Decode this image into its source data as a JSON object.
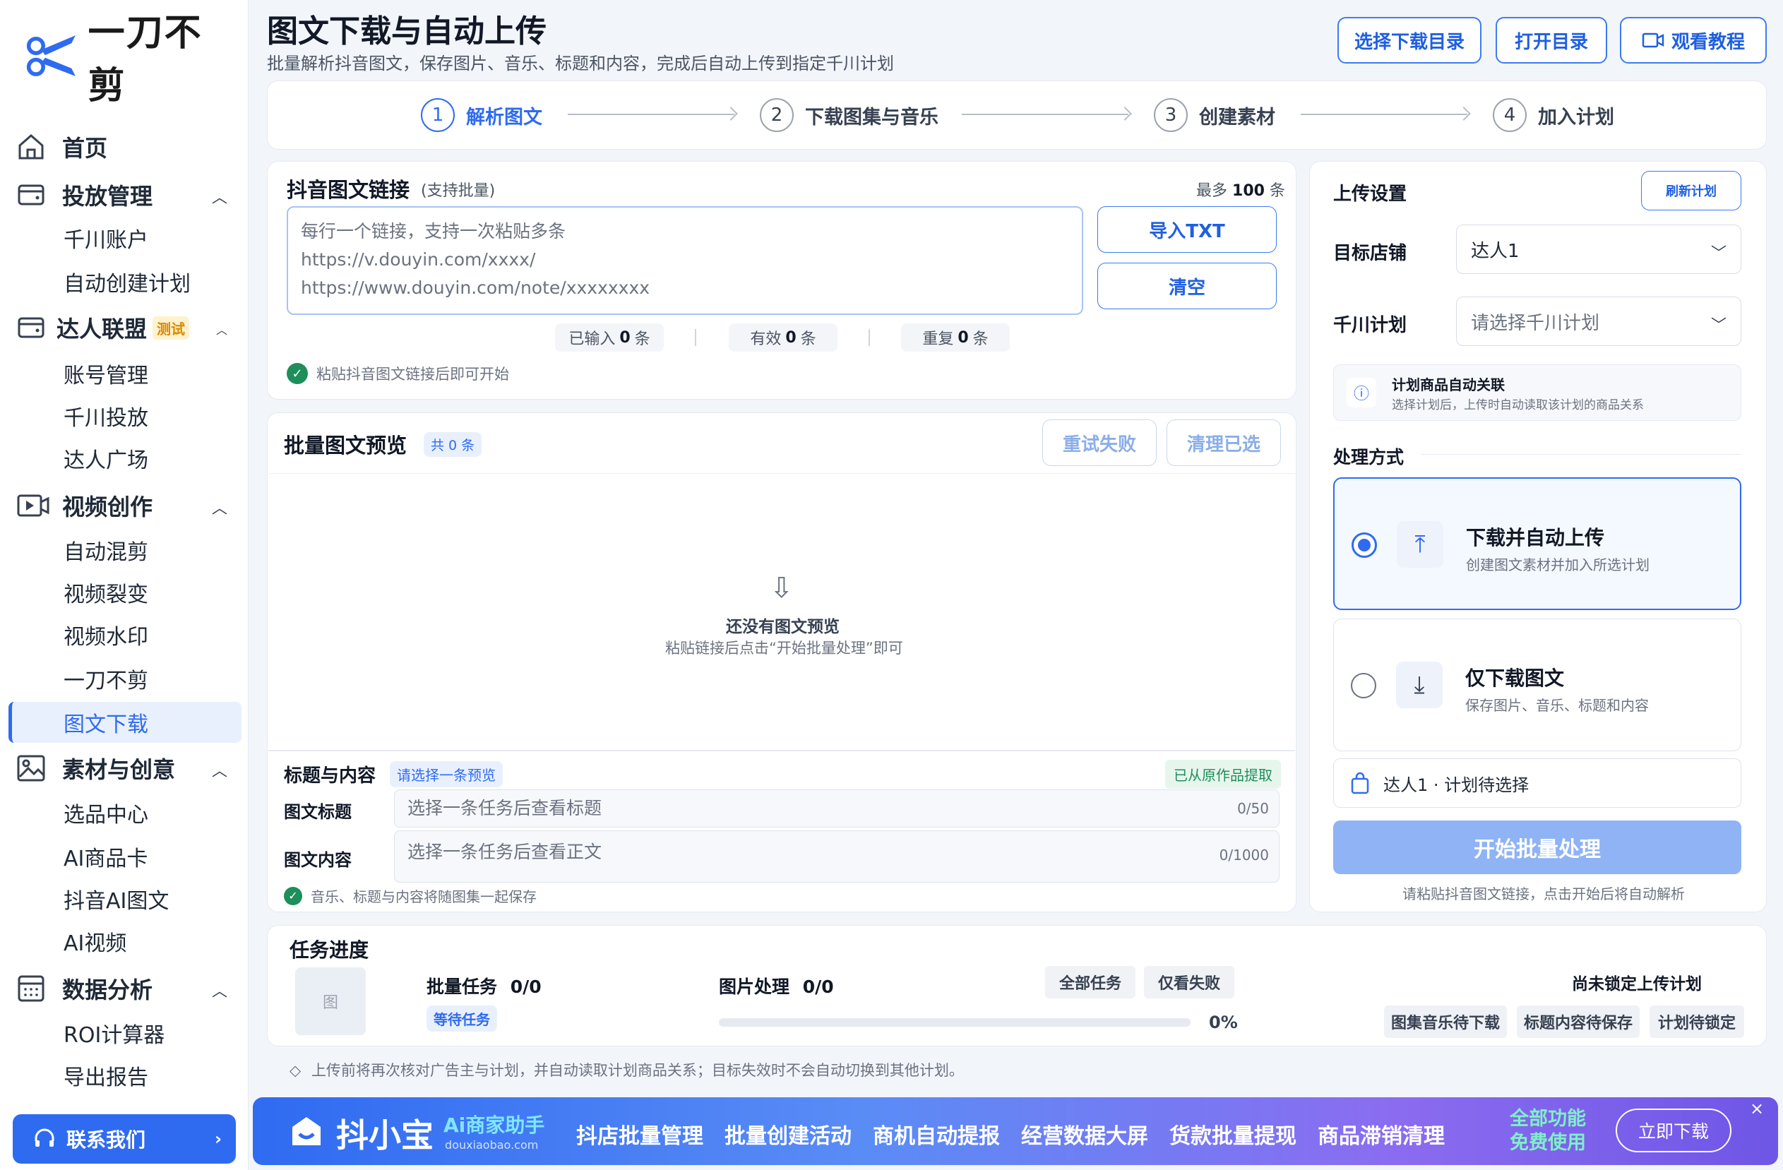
{
  "sidebar": {
    "logo_text": "一刀不剪",
    "home": "首页",
    "groups": [
      {
        "label": "投放管理",
        "items": [
          "千川账户",
          "自动创建计划"
        ]
      },
      {
        "label": "达人联盟",
        "badge": "测试",
        "items": [
          "账号管理",
          "千川投放",
          "达人广场"
        ]
      },
      {
        "label": "视频创作",
        "items": [
          "自动混剪",
          "视频裂变",
          "视频水印",
          "一刀不剪",
          "图文下载"
        ]
      },
      {
        "label": "素材与创意",
        "items": [
          "选品中心",
          "AI商品卡",
          "抖音AI图文",
          "AI视频"
        ]
      },
      {
        "label": "数据分析",
        "items": [
          "ROI计算器",
          "导出报告"
        ]
      }
    ],
    "active_item": "图文下载",
    "contact": "联系我们"
  },
  "header": {
    "title": "图文下载与自动上传",
    "subtitle": "批量解析抖音图文，保存图片、音乐、标题和内容，完成后自动上传到指定千川计划",
    "btn_select_dir": "选择下载目录",
    "btn_open_dir": "打开目录",
    "btn_tutorial": "观看教程"
  },
  "steps": [
    {
      "num": "1",
      "label": "解析图文"
    },
    {
      "num": "2",
      "label": "下载图集与音乐"
    },
    {
      "num": "3",
      "label": "创建素材"
    },
    {
      "num": "4",
      "label": "加入计划"
    }
  ],
  "links": {
    "title": "抖音图文链接",
    "hint": "(支持批量)",
    "max_prefix": "最多",
    "max_num": "100",
    "max_suffix": "条",
    "placeholder_lines": [
      "每行一个链接，支持一次粘贴多条",
      "https://v.douyin.com/xxxx/",
      "https://www.douyin.com/note/xxxxxxxx"
    ],
    "btn_import": "导入TXT",
    "btn_clear": "清空",
    "stats": [
      {
        "label": "已输入",
        "value": "0",
        "unit": "条"
      },
      {
        "label": "有效",
        "value": "0",
        "unit": "条"
      },
      {
        "label": "重复",
        "value": "0",
        "unit": "条"
      }
    ],
    "tip": "粘贴抖音图文链接后即可开始"
  },
  "preview": {
    "title": "批量图文预览",
    "count": "共 0 条",
    "btn_retry": "重试失败",
    "btn_clear_sel": "清理已选",
    "empty_title": "还没有图文预览",
    "empty_desc": "粘贴链接后点击“开始批量处理”即可",
    "meta_title": "标题与内容",
    "meta_chip": "请选择一条预览",
    "meta_badge": "已从原作品提取",
    "label_title": "图文标题",
    "title_placeholder": "选择一条任务后查看标题",
    "title_count": "0/50",
    "label_content": "图文内容",
    "content_placeholder": "选择一条任务后查看正文",
    "content_count": "0/1000",
    "save_tip": "音乐、标题与内容将随图集一起保存"
  },
  "upload": {
    "title": "上传设置",
    "btn_refresh": "刷新计划",
    "shop_label": "目标店铺",
    "shop_value": "达人1",
    "plan_label": "千川计划",
    "plan_placeholder": "请选择千川计划",
    "info_title": "计划商品自动关联",
    "info_desc": "选择计划后，上传时自动读取该计划的商品关系",
    "mode_label": "处理方式",
    "options": [
      {
        "title": "下载并自动上传",
        "desc": "创建图文素材并加入所选计划",
        "selected": true
      },
      {
        "title": "仅下载图文",
        "desc": "保存图片、音乐、标题和内容",
        "selected": false
      }
    ],
    "target": "达人1 · 计划待选择",
    "btn_start": "开始批量处理",
    "start_tip": "请粘贴抖音图文链接，点击开始后将自动解析"
  },
  "progress": {
    "title": "任务进度",
    "thumb": "图",
    "batch_label": "批量任务",
    "batch_value": "0/0",
    "batch_status": "等待任务",
    "image_label": "图片处理",
    "image_value": "0/0",
    "image_progress": 0,
    "percent": "0%",
    "btn_all": "全部任务",
    "btn_failed": "仅看失败",
    "lock_status": "尚未锁定上传计划",
    "tags": [
      "图集音乐待下载",
      "标题内容待保存",
      "计划待锁定"
    ]
  },
  "footnote": "上传前将再次核对广告主与计划，并自动读取计划商品关系；目标失效时不会自动切换到其他计划。",
  "banner": {
    "brand": "抖小宝",
    "sub": "Ai商家助手",
    "domain": "douxiaobao.com",
    "features": [
      "抖店批量管理",
      "批量创建活动",
      "商机自动提报",
      "经营数据大屏",
      "货款批量提现",
      "商品滞销清理"
    ],
    "promo_line1": "全部功能",
    "promo_line2": "免费使用",
    "btn": "立即下载",
    "close": "×"
  },
  "colors": {
    "accent": "#2f6bf1",
    "success": "#1e8e5a",
    "warning": "#d88a00"
  }
}
